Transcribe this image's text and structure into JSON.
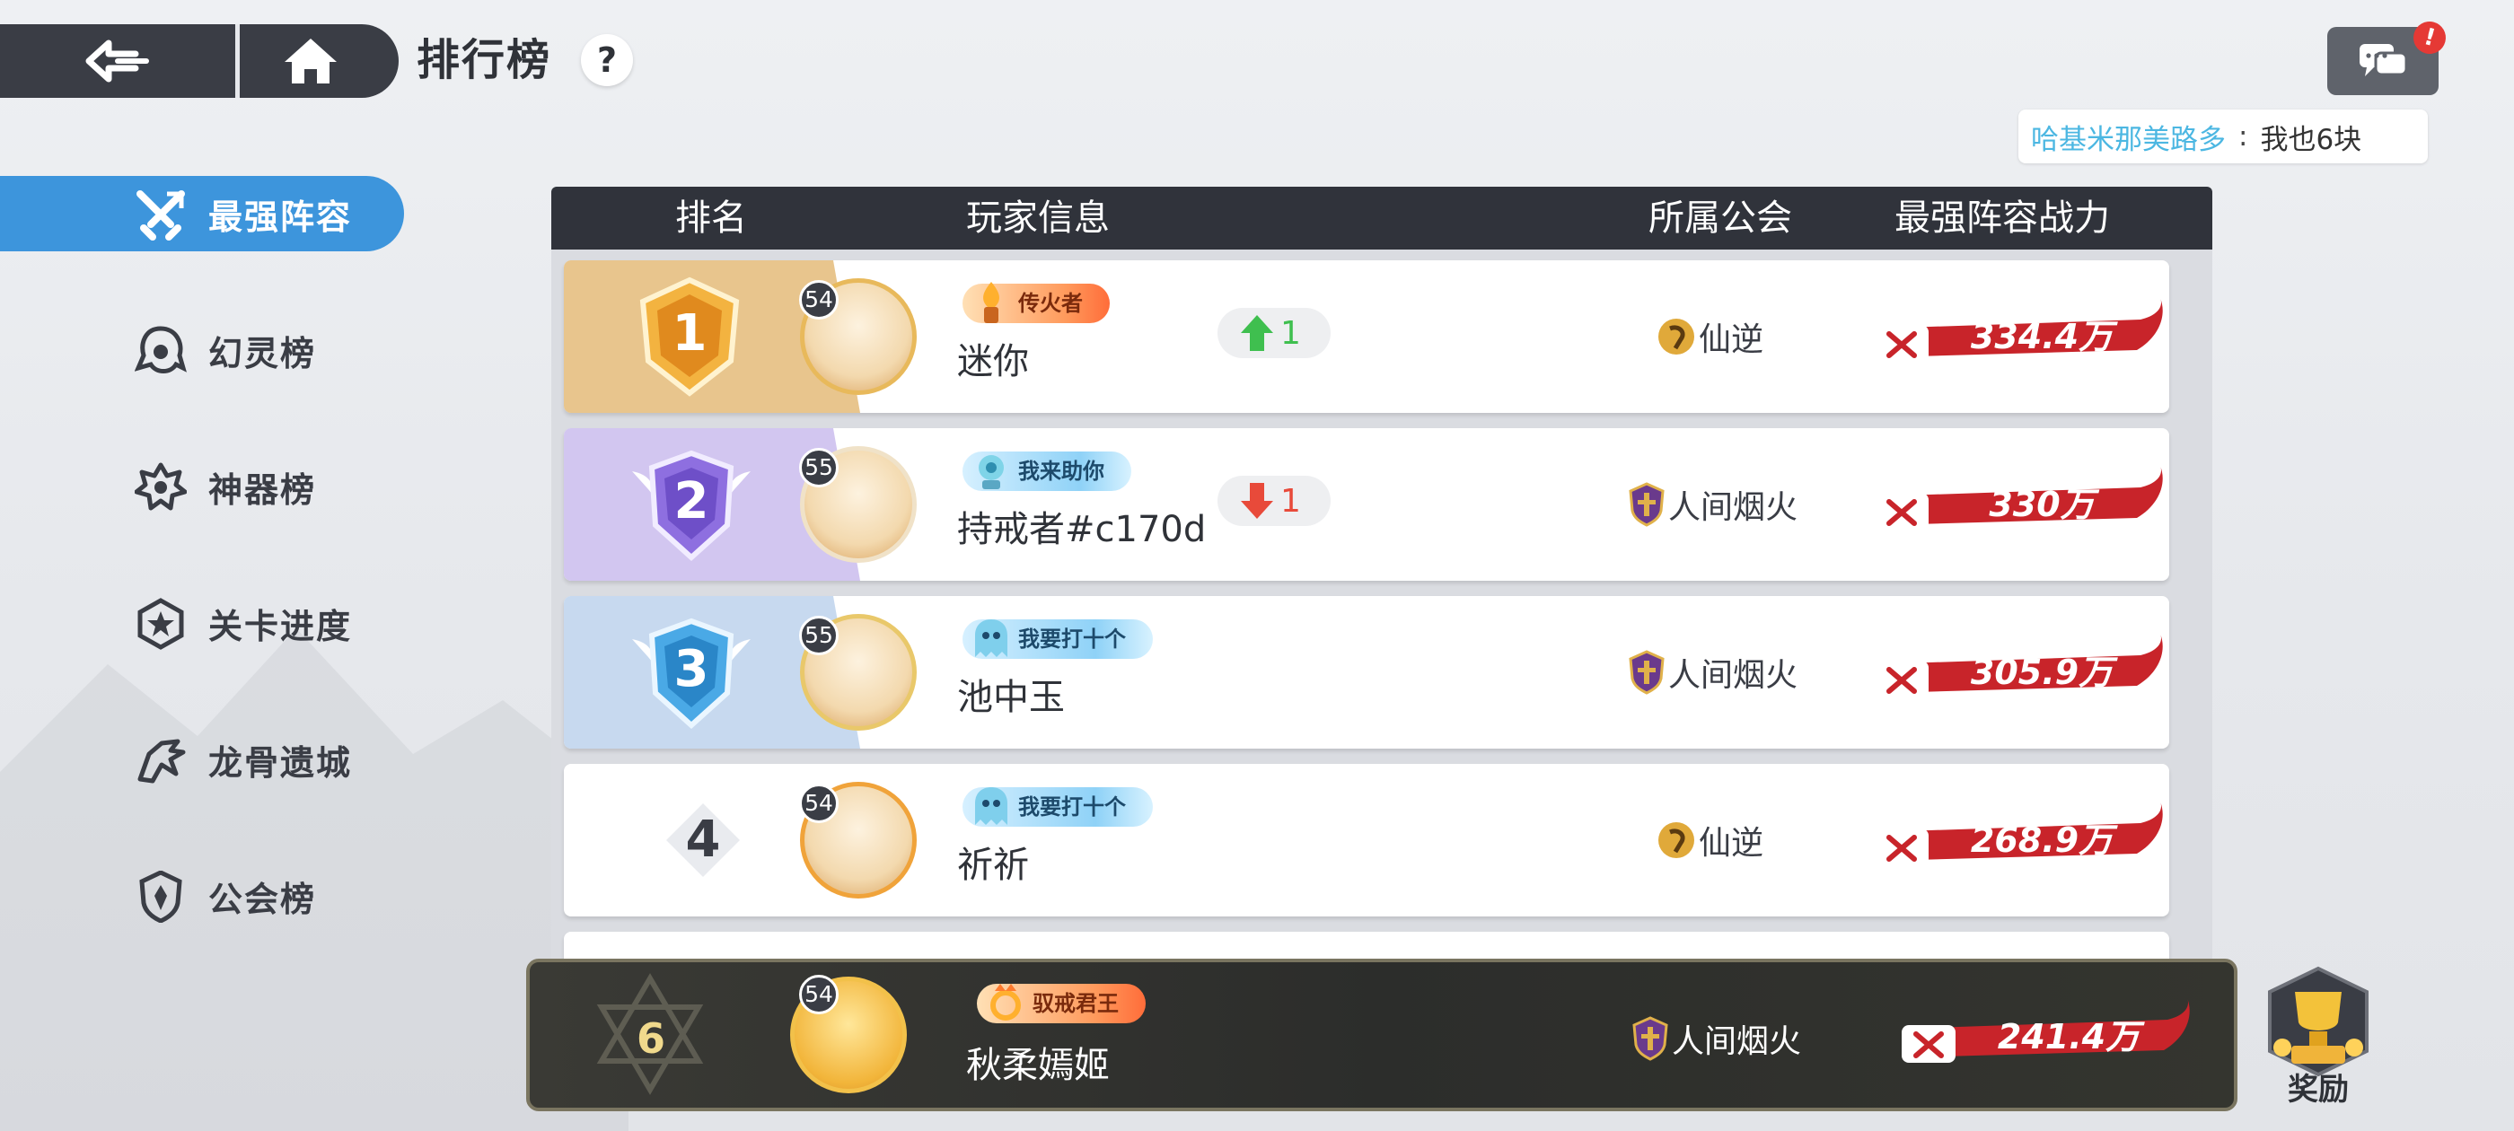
{
  "header": {
    "title": "排行榜",
    "help_label": "?"
  },
  "chat": {
    "alert": "!",
    "sender": "哈基米那美路多",
    "colon": ":",
    "message": "我也6块"
  },
  "sidebar": {
    "items": [
      {
        "label": "最强阵容",
        "icon": "crossed-swords-icon",
        "active": true
      },
      {
        "label": "幻灵榜",
        "icon": "spirit-icon",
        "active": false
      },
      {
        "label": "神器榜",
        "icon": "artifact-icon",
        "active": false
      },
      {
        "label": "关卡进度",
        "icon": "star-badge-icon",
        "active": false
      },
      {
        "label": "龙骨遗城",
        "icon": "dragon-icon",
        "active": false
      },
      {
        "label": "公会榜",
        "icon": "guild-shield-icon",
        "active": false
      }
    ]
  },
  "table": {
    "columns": [
      "排名",
      "玩家信息",
      "所属公会",
      "最强阵容战力"
    ],
    "rows": [
      {
        "rank": "1",
        "level": "54",
        "title": "传火者",
        "name": "迷你",
        "trend": "1",
        "trend_dir": "up",
        "guild": "仙逆",
        "power": "334.4万"
      },
      {
        "rank": "2",
        "level": "55",
        "title": "我来助你",
        "name": "持戒者#c170d",
        "trend": "1",
        "trend_dir": "down",
        "guild": "人间烟火",
        "power": "330万"
      },
      {
        "rank": "3",
        "level": "55",
        "title": "我要打十个",
        "name": "池中玉",
        "trend": "",
        "trend_dir": "none",
        "guild": "人间烟火",
        "power": "305.9万"
      },
      {
        "rank": "4",
        "level": "54",
        "title": "我要打十个",
        "name": "祈祈",
        "trend": "",
        "trend_dir": "none",
        "guild": "仙逆",
        "power": "268.9万"
      }
    ]
  },
  "self": {
    "rank": "6",
    "level": "54",
    "title": "驭戒君王",
    "name": "秋柔嫣姬",
    "guild": "人间烟火",
    "power": "241.4万"
  },
  "reward": {
    "label": "奖励"
  },
  "colors": {
    "accent": "#3d95dc",
    "header_bg": "#30333b",
    "power_red": "#c8242a",
    "trend_up": "#3fbf4f",
    "trend_down": "#e84a3a"
  }
}
